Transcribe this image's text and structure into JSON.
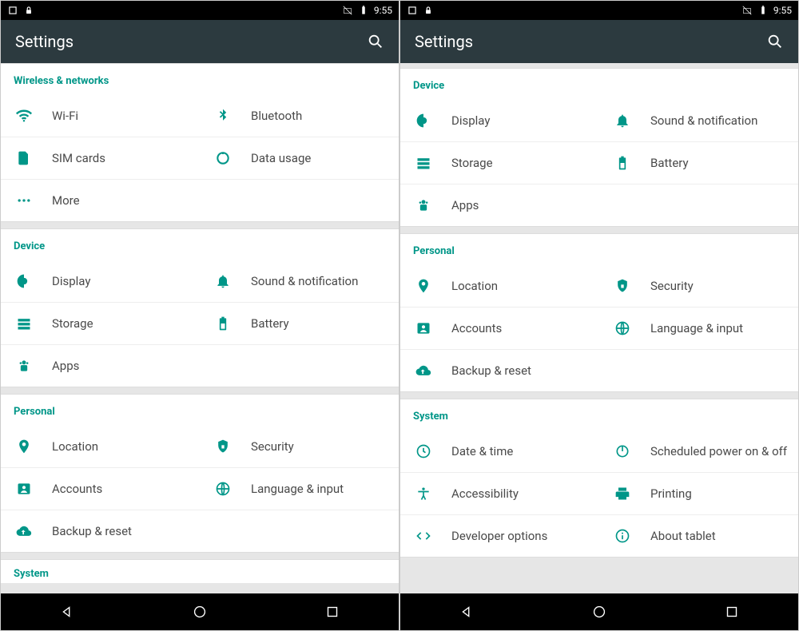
{
  "status": {
    "time": "9:55"
  },
  "app": {
    "title": "Settings"
  },
  "left_panel": {
    "sections": [
      {
        "header": "Wireless & networks",
        "rows": [
          {
            "icon": "wifi",
            "label": "Wi-Fi"
          },
          {
            "icon": "bluetooth",
            "label": "Bluetooth"
          },
          {
            "icon": "sim",
            "label": "SIM cards"
          },
          {
            "icon": "data",
            "label": "Data usage"
          },
          {
            "icon": "more",
            "label": "More",
            "full": true
          }
        ]
      },
      {
        "header": "Device",
        "rows": [
          {
            "icon": "display",
            "label": "Display"
          },
          {
            "icon": "bell",
            "label": "Sound & notification"
          },
          {
            "icon": "storage",
            "label": "Storage"
          },
          {
            "icon": "battery",
            "label": "Battery"
          },
          {
            "icon": "apps",
            "label": "Apps",
            "full": true
          }
        ]
      },
      {
        "header": "Personal",
        "rows": [
          {
            "icon": "location",
            "label": "Location"
          },
          {
            "icon": "security",
            "label": "Security"
          },
          {
            "icon": "accounts",
            "label": "Accounts"
          },
          {
            "icon": "language",
            "label": "Language & input"
          },
          {
            "icon": "backup",
            "label": "Backup & reset",
            "full": true
          }
        ]
      }
    ],
    "partial": "System"
  },
  "right_panel": {
    "sections": [
      {
        "header": "Device",
        "rows": [
          {
            "icon": "display",
            "label": "Display"
          },
          {
            "icon": "bell",
            "label": "Sound & notification"
          },
          {
            "icon": "storage",
            "label": "Storage"
          },
          {
            "icon": "battery",
            "label": "Battery"
          },
          {
            "icon": "apps",
            "label": "Apps",
            "full": true
          }
        ]
      },
      {
        "header": "Personal",
        "rows": [
          {
            "icon": "location",
            "label": "Location"
          },
          {
            "icon": "security",
            "label": "Security"
          },
          {
            "icon": "accounts",
            "label": "Accounts"
          },
          {
            "icon": "language",
            "label": "Language & input"
          },
          {
            "icon": "backup",
            "label": "Backup & reset",
            "full": true
          }
        ]
      },
      {
        "header": "System",
        "rows": [
          {
            "icon": "clock",
            "label": "Date & time"
          },
          {
            "icon": "power",
            "label": "Scheduled power on & off"
          },
          {
            "icon": "accessibility",
            "label": "Accessibility"
          },
          {
            "icon": "print",
            "label": "Printing"
          },
          {
            "icon": "dev",
            "label": "Developer options"
          },
          {
            "icon": "info",
            "label": "About tablet"
          }
        ]
      }
    ]
  }
}
